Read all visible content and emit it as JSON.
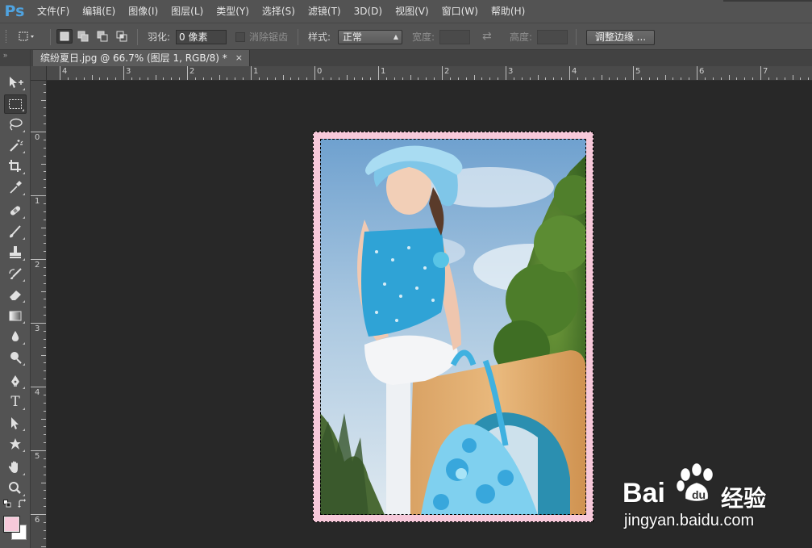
{
  "app": {
    "logo": "Ps",
    "menu": [
      "文件(F)",
      "编辑(E)",
      "图像(I)",
      "图层(L)",
      "类型(Y)",
      "选择(S)",
      "滤镜(T)",
      "3D(D)",
      "视图(V)",
      "窗口(W)",
      "帮助(H)"
    ]
  },
  "options": {
    "feather_label": "羽化:",
    "feather_value": "0 像素",
    "antialias_label": "消除锯齿",
    "style_label": "样式:",
    "style_value": "正常",
    "width_label": "宽度:",
    "height_label": "高度:",
    "refine_edge_button": "调整边缘 ..."
  },
  "document": {
    "tab_title": "缤纷夏日.jpg @ 66.7% (图层 1, RGB/8) *",
    "close": "×"
  },
  "rulers": {
    "horizontal_labels": [
      "4",
      "3",
      "2",
      "1",
      "0",
      "1",
      "2",
      "3",
      "4",
      "5",
      "6",
      "7"
    ],
    "vertical_labels": [
      "0",
      "1",
      "2",
      "3",
      "4",
      "5",
      "6"
    ]
  },
  "toolbar": {
    "collapse_glyph": "»",
    "text_tool_glyph": "T"
  },
  "colors": {
    "foreground": "#f7c9da",
    "background": "#ffffff",
    "frame": "#f7c9da"
  },
  "watermark": {
    "brand": "Bai",
    "brand_suffix": "经验",
    "url": "jingyan.baidu.com"
  }
}
